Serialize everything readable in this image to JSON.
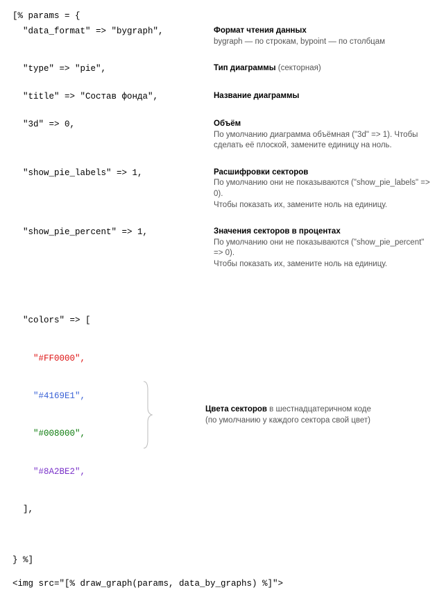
{
  "code": {
    "open": "[% params = {",
    "data_format": "  \"data_format\" => \"bygraph\",",
    "type": "  \"type\" => \"pie\",",
    "title": "  \"title\" => \"Состав фонда\",",
    "three_d": "  \"3d\" => 0,",
    "show_labels": "  \"show_pie_labels\" => 1,",
    "show_percent": "  \"show_pie_percent\" => 1,",
    "colors_open": "  \"colors\" => [",
    "color1": "    \"#FF0000\",",
    "color2": "    \"#4169E1\",",
    "color3": "    \"#008000\",",
    "color4": "    \"#8A2BE2\",",
    "colors_close": "  ],",
    "close": "} %]",
    "footer": "<img src=\"[% draw_graph(params, data_by_graphs) %]\">"
  },
  "desc": {
    "data_format_title": "Формат чтения данных",
    "data_format_body": "bygraph — по строкам, bypoint — по столбцам",
    "type_title": "Тип диаграммы",
    "type_paren": " (секторная)",
    "title_title": "Название диаграммы",
    "three_d_title": "Объём",
    "three_d_body": "По умолчанию диаграмма объёмная (\"3d\" => 1). Чтобы сделать её плоской, замените единицу на ноль.",
    "labels_title": "Расшифровки секторов",
    "labels_body": "По умолчанию они не показываются (\"show_pie_labels\" => 0).\nЧтобы показать их, замените ноль на единицу.",
    "percent_title": "Значения секторов в процентах",
    "percent_body": "По умолчанию они не показываются (\"show_pie_percent\" => 0).\nЧтобы показать их, замените ноль на единицу.",
    "colors_title": "Цвета секторов",
    "colors_body": " в шестнадцатеричном коде\n(по умолчанию у каждого сектора свой цвет)"
  }
}
